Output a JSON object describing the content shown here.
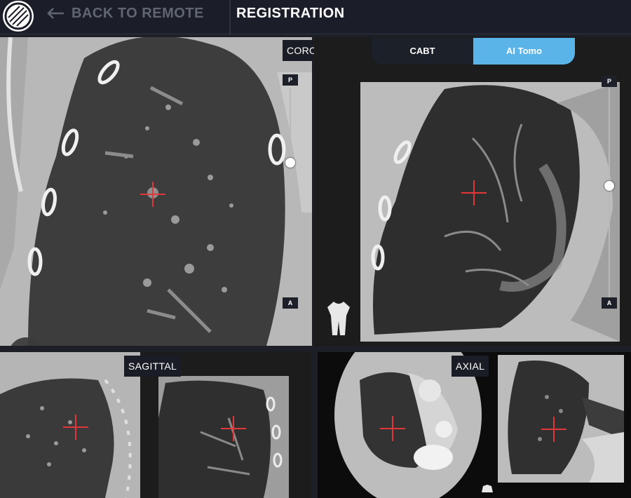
{
  "header": {
    "back_label": "BACK TO REMOTE",
    "title": "REGISTRATION"
  },
  "views": {
    "coronal": "CORONAL",
    "sagittal": "SAGITTAL",
    "axial": "AXIAL"
  },
  "toggle": {
    "options": [
      "CABT",
      "AI Tomo"
    ],
    "selected": "AI Tomo"
  },
  "sliders": {
    "left": {
      "top_tag": "P",
      "bottom_tag": "A",
      "position": 0.43
    },
    "right": {
      "top_tag": "P",
      "bottom_tag": "A",
      "position": 0.42
    }
  },
  "colors": {
    "accent": "#5ab4e8",
    "crosshair": "#e0383a",
    "panel_bg": "#1a1d25"
  },
  "icons": [
    "logo-icon",
    "back-arrow-icon",
    "zoom-out-icon",
    "body-orientation-icon"
  ]
}
